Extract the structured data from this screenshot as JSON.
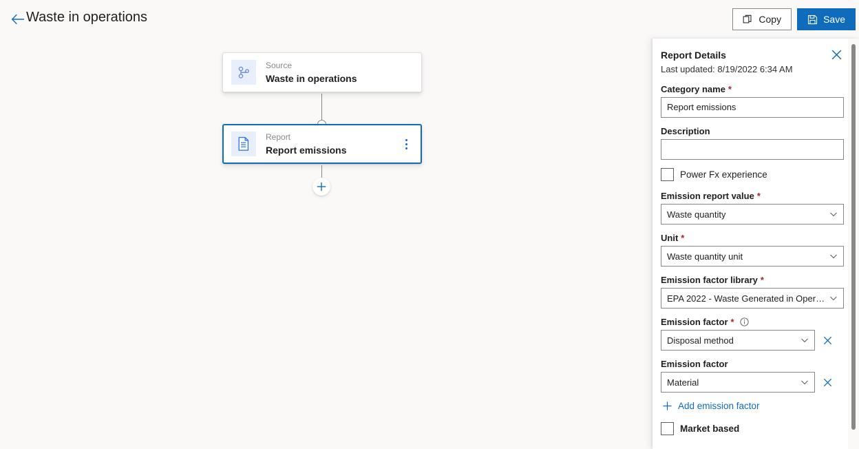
{
  "topbar": {
    "back_icon": "arrow-left-icon",
    "title": "Waste in operations",
    "copy_label": "Copy",
    "save_label": "Save",
    "copy_icon": "copy-icon",
    "save_icon": "save-disk-icon"
  },
  "canvas": {
    "nodes": [
      {
        "kind": "Source",
        "name": "Waste in operations",
        "icon": "branch-icon",
        "selected": false,
        "has_menu": false
      },
      {
        "kind": "Report",
        "name": "Report emissions",
        "icon": "document-icon",
        "selected": true,
        "has_menu": true
      }
    ],
    "add_node_icon": "plus-icon"
  },
  "panel": {
    "title": "Report Details",
    "close_icon": "close-icon",
    "last_updated": "Last updated: 8/19/2022 6:34 AM",
    "fields": {
      "category_name": {
        "label": "Category name",
        "required": "*",
        "value": "Report emissions"
      },
      "description": {
        "label": "Description",
        "value": ""
      },
      "power_fx": {
        "label": "Power Fx experience",
        "checked": false
      },
      "emission_report_value": {
        "label": "Emission report value",
        "required": "*",
        "value": "Waste quantity"
      },
      "unit": {
        "label": "Unit",
        "required": "*",
        "value": "Waste quantity unit"
      },
      "emission_factor_library": {
        "label": "Emission factor library",
        "required": "*",
        "value": "EPA 2022 - Waste Generated in Opera..."
      },
      "emission_factor_1": {
        "label": "Emission factor",
        "required": "*",
        "info_icon": "info-icon",
        "value": "Disposal method",
        "remove_icon": "close-icon"
      },
      "emission_factor_2": {
        "label": "Emission factor",
        "value": "Material",
        "remove_icon": "close-icon"
      },
      "add_emission_factor": {
        "label": "Add emission factor",
        "icon": "plus-icon"
      },
      "market_based": {
        "label": "Market based",
        "checked": false
      }
    }
  },
  "colors": {
    "accent": "#0f6cbd",
    "required": "#a4262c",
    "canvas_bg": "#faf9f8",
    "panel_bg": "#ffffff",
    "node_icon_bg": "#e8eefc",
    "border": "#8a8886"
  }
}
